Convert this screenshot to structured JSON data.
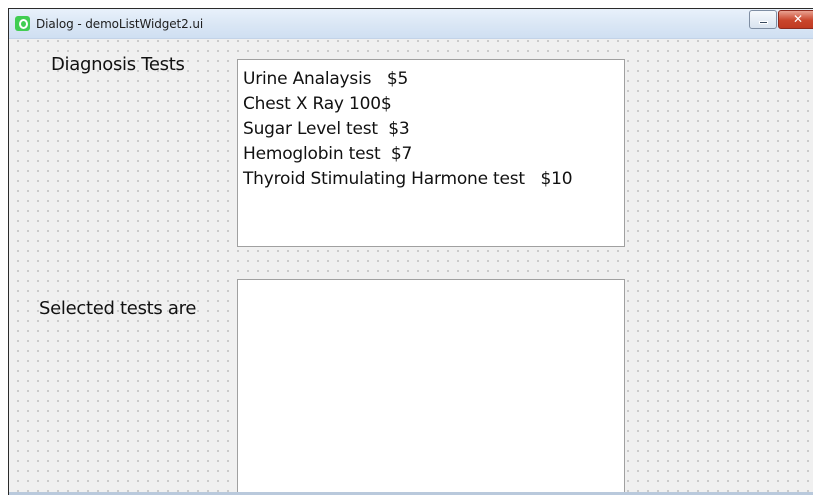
{
  "window": {
    "title": "Dialog - demoListWidget2.ui",
    "minimize_label": "—",
    "close_label": "✕"
  },
  "labels": {
    "diagnosis": "Diagnosis Tests",
    "selected": "Selected tests are"
  },
  "tests_list": {
    "items": [
      "Urine Analaysis   $5",
      "Chest X Ray 100$",
      "Sugar Level test  $3",
      "Hemoglobin test  $7",
      "Thyroid Stimulating Harmone test   $10"
    ]
  },
  "selected_list": {
    "items": []
  },
  "colors": {
    "app_icon": "#41cd52",
    "close_button": "#c9452c",
    "canvas": "#f0f0f0"
  }
}
